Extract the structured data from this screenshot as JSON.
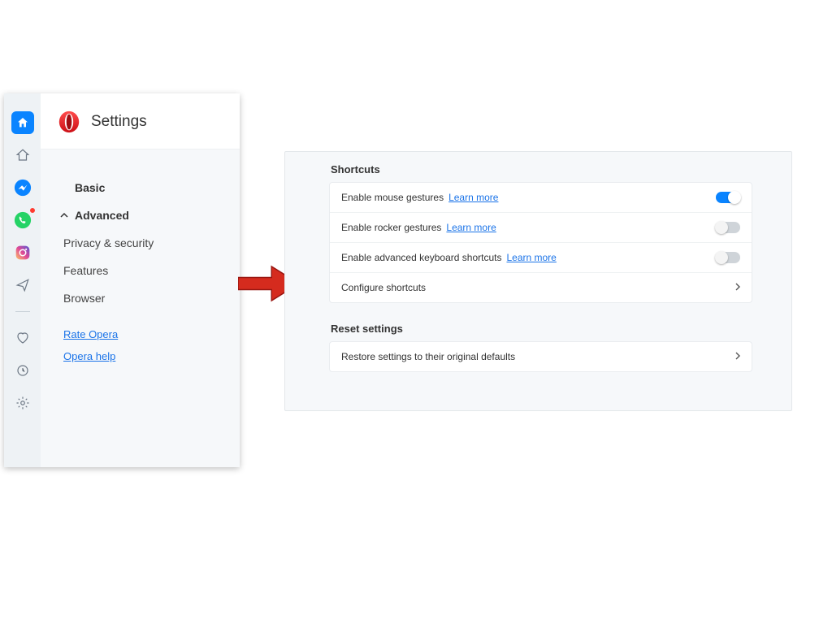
{
  "header": {
    "title": "Settings"
  },
  "nav": {
    "basic": "Basic",
    "advanced": "Advanced",
    "items": [
      "Privacy & security",
      "Features",
      "Browser"
    ],
    "rate_link": "Rate Opera",
    "help_link": "Opera help"
  },
  "rail_icons": {
    "home": "home-icon",
    "speed_dial": "home-outline-icon",
    "messenger": "messenger-icon",
    "whatsapp": "whatsapp-icon",
    "instagram": "instagram-icon",
    "send": "send-icon",
    "heart": "heart-icon",
    "history": "history-icon",
    "settings_gear": "gear-icon"
  },
  "shortcuts": {
    "title": "Shortcuts",
    "rows": [
      {
        "label": "Enable mouse gestures",
        "learn": "Learn more",
        "on": true
      },
      {
        "label": "Enable rocker gestures",
        "learn": "Learn more",
        "on": false
      },
      {
        "label": "Enable advanced keyboard shortcuts",
        "learn": "Learn more",
        "on": false
      }
    ],
    "configure": "Configure shortcuts"
  },
  "reset": {
    "title": "Reset settings",
    "restore": "Restore settings to their original defaults"
  },
  "colors": {
    "accent": "#0a84ff",
    "link": "#1a73e8",
    "arrow": "#d52b1e"
  }
}
